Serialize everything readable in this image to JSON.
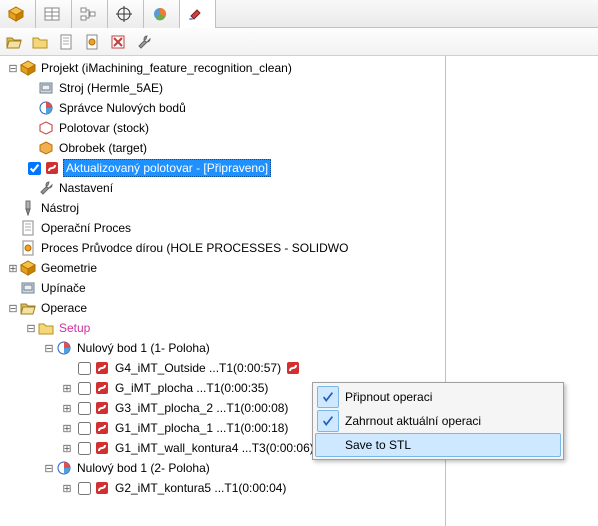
{
  "toolbar_tabs": [
    "cube",
    "table",
    "tree",
    "target",
    "pie",
    "paint"
  ],
  "toolbar2": [
    "open",
    "new-folder",
    "new-doc",
    "settings-doc",
    "delete-doc",
    "wrench"
  ],
  "project": {
    "label": "Projekt (iMachining_feature_recognition_clean)",
    "children": {
      "stroj": "Stroj (Hermle_5AE)",
      "spravce": "Správce Nulových bodů",
      "polotovar": "Polotovar (stock)",
      "obrobek": "Obrobek (target)",
      "aktualizovany": "Aktualizovaný polotovar - [Připraveno]",
      "nastaveni": "Nastavení"
    }
  },
  "nastroj": "Nástroj",
  "operacni_proces": "Operační Proces",
  "proces_pruvodce": "Proces Průvodce dírou (HOLE PROCESSES - SOLIDWO",
  "geometrie": "Geometrie",
  "upinace": "Upínače",
  "operace": {
    "label": "Operace",
    "setup": "Setup",
    "nb1": {
      "label": "Nulový bod 1 (1- Poloha)",
      "ops": [
        "G4_iMT_Outside ...T1(0:00:57)",
        "G_iMT_plocha ...T1(0:00:35)",
        "G3_iMT_plocha_2 ...T1(0:00:08)",
        "G1_iMT_plocha_1 ...T1(0:00:18)",
        "G1_iMT_wall_kontura4 ...T3(0:00:06)"
      ]
    },
    "nb2": {
      "label": "Nulový bod 1 (2- Poloha)",
      "ops": [
        "G2_iMT_kontura5 ...T1(0:00:04)"
      ]
    }
  },
  "context_menu": {
    "items": [
      {
        "label": "Připnout operaci",
        "checked": true
      },
      {
        "label": "Zahrnout aktuální operaci",
        "checked": true
      },
      {
        "label": "Save to STL",
        "checked": false,
        "hover": true
      }
    ]
  }
}
